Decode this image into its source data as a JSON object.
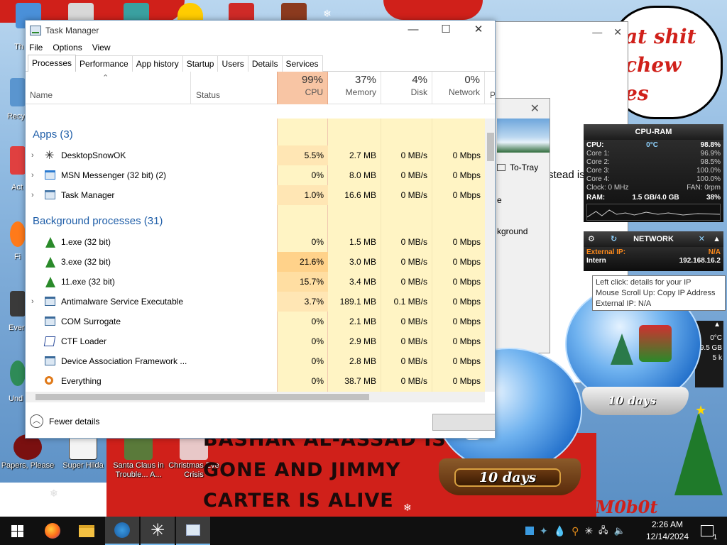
{
  "desktop": {
    "speech_text": "at shit\nchew\nes",
    "banner_lines": [
      "BASHAR AL-ASSAD IS",
      "GONE AND JIMMY",
      "CARTER IS ALIVE"
    ],
    "signature": "VM0b0t",
    "icons": [
      {
        "label": "Papers, Please"
      },
      {
        "label": "Super Hilda"
      },
      {
        "label": "Santa Claus in Trouble... A..."
      },
      {
        "label": "Christmas Eve Crisis"
      }
    ],
    "edge_labels": [
      "Th",
      "Recy",
      "Act",
      "Fi",
      "Ever",
      "Und"
    ],
    "behind_text": "stead is",
    "behind_dialog": {
      "totray": "To-Tray",
      "e_text": "e",
      "kg_text": "kground"
    }
  },
  "task_manager": {
    "title": "Task Manager",
    "menu": [
      "File",
      "Options",
      "View"
    ],
    "tabs": [
      "Processes",
      "Performance",
      "App history",
      "Startup",
      "Users",
      "Details",
      "Services"
    ],
    "columns": {
      "name": "Name",
      "status": "Status",
      "cpu": {
        "pct": "99%",
        "label": "CPU"
      },
      "memory": {
        "pct": "37%",
        "label": "Memory"
      },
      "disk": {
        "pct": "4%",
        "label": "Disk"
      },
      "network": {
        "pct": "0%",
        "label": "Network"
      },
      "power": "P"
    },
    "groups": {
      "apps": "Apps (3)",
      "background": "Background processes (31)"
    },
    "apps": [
      {
        "name": "DesktopSnowOK",
        "cpu": "5.5%",
        "memory": "2.7 MB",
        "disk": "0 MB/s",
        "network": "0 Mbps",
        "icon": "snowflake-icon",
        "expand": true
      },
      {
        "name": "MSN Messenger (32 bit) (2)",
        "cpu": "0%",
        "memory": "8.0 MB",
        "disk": "0 MB/s",
        "network": "0 Mbps",
        "icon": "messenger-icon",
        "expand": true
      },
      {
        "name": "Task Manager",
        "cpu": "1.0%",
        "memory": "16.6 MB",
        "disk": "0 MB/s",
        "network": "0 Mbps",
        "icon": "taskmanager-icon",
        "expand": true
      }
    ],
    "background": [
      {
        "name": "1.exe (32 bit)",
        "cpu": "0%",
        "memory": "1.5 MB",
        "disk": "0 MB/s",
        "network": "0 Mbps",
        "icon": "tree-icon",
        "expand": false
      },
      {
        "name": "3.exe (32 bit)",
        "cpu": "21.6%",
        "memory": "3.0 MB",
        "disk": "0 MB/s",
        "network": "0 Mbps",
        "icon": "tree-icon",
        "expand": false
      },
      {
        "name": "11.exe (32 bit)",
        "cpu": "15.7%",
        "memory": "3.4 MB",
        "disk": "0 MB/s",
        "network": "0 Mbps",
        "icon": "tree-icon",
        "expand": false
      },
      {
        "name": "Antimalware Service Executable",
        "cpu": "3.7%",
        "memory": "189.1 MB",
        "disk": "0.1 MB/s",
        "network": "0 Mbps",
        "icon": "service-icon",
        "expand": true
      },
      {
        "name": "COM Surrogate",
        "cpu": "0%",
        "memory": "2.1 MB",
        "disk": "0 MB/s",
        "network": "0 Mbps",
        "icon": "service-icon",
        "expand": false
      },
      {
        "name": "CTF Loader",
        "cpu": "0%",
        "memory": "2.9 MB",
        "disk": "0 MB/s",
        "network": "0 Mbps",
        "icon": "pen-icon",
        "expand": false
      },
      {
        "name": "Device Association Framework ...",
        "cpu": "0%",
        "memory": "2.8 MB",
        "disk": "0 MB/s",
        "network": "0 Mbps",
        "icon": "service-icon",
        "expand": false
      },
      {
        "name": "Everything",
        "cpu": "0%",
        "memory": "38.7 MB",
        "disk": "0 MB/s",
        "network": "0 Mbps",
        "icon": "magnifier-icon",
        "expand": false
      }
    ],
    "fewer_details": "Fewer details"
  },
  "cpu_ram_gadget": {
    "title": "CPU-RAM",
    "cpu_label": "CPU:",
    "cpu_temp": "0°C",
    "cpu_value": "98.8%",
    "cores": [
      {
        "label": "Core 1:",
        "value": "96.9%"
      },
      {
        "label": "Core 2:",
        "value": "98.5%"
      },
      {
        "label": "Core 3:",
        "value": "100.0%"
      },
      {
        "label": "Core 4:",
        "value": "100.0%"
      }
    ],
    "clock_label": "Clock: 0 MHz",
    "fan_label": "FAN: 0rpm",
    "ram_label": "RAM:",
    "ram_value": "1.5 GB/4.0 GB",
    "ram_pct": "38%"
  },
  "network_gadget": {
    "title": "NETWORK",
    "external_label": "External IP:",
    "external_value": "N/A",
    "internal_label": "Intern",
    "internal_value": "192.168.16.2"
  },
  "tooltip": {
    "lines": [
      "Left click: details for your IP",
      "Mouse Scroll Up: Copy IP Address",
      "External IP: N/A"
    ]
  },
  "mini_gadget": {
    "temp": "0°C",
    "size": "9.5 GB",
    "small": "5 k"
  },
  "globes": {
    "small_label": "10 days",
    "large_label": "10 days"
  },
  "taskbar": {
    "time": "2:26 AM",
    "date": "12/14/2024",
    "notification_count": "1"
  }
}
